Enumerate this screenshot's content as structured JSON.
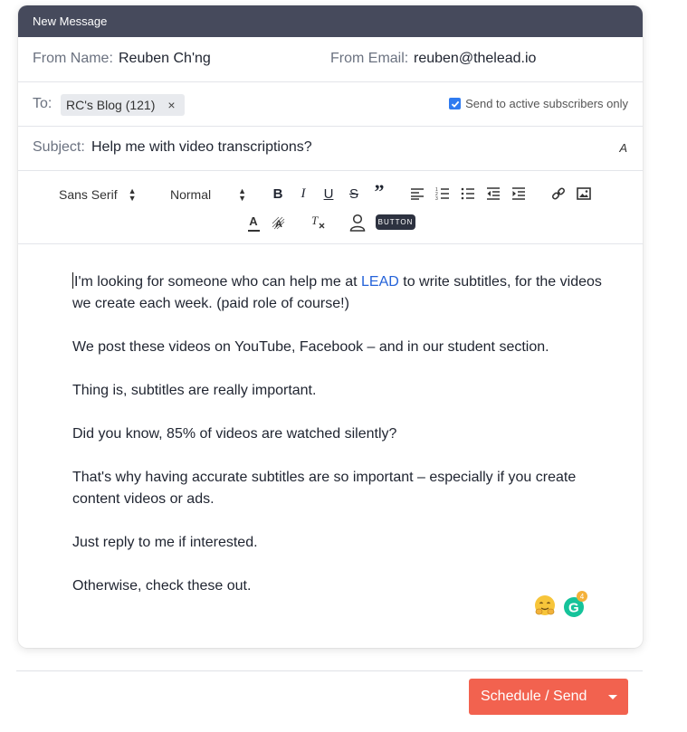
{
  "window": {
    "title": "New Message"
  },
  "from": {
    "name_label": "From Name:",
    "name_value": "Reuben Ch'ng",
    "email_label": "From Email:",
    "email_value": "reuben@thelead.io"
  },
  "to": {
    "label": "To:",
    "chip_label": "RC's Blog (121)",
    "chip_remove": "×",
    "checkbox_label": "Send to active subscribers only",
    "checkbox_checked": true
  },
  "subject": {
    "label": "Subject:",
    "value": "Help me with video transcriptions?",
    "format_icon": "A"
  },
  "toolbar": {
    "font_select": "Sans Serif",
    "size_select": "Normal",
    "button_chip": "BUTTON",
    "icons": [
      "bold-icon",
      "italic-icon",
      "underline-icon",
      "strikethrough-icon",
      "blockquote-icon",
      "align-left-icon",
      "ordered-list-icon",
      "bullet-list-icon",
      "outdent-icon",
      "indent-icon",
      "link-icon",
      "image-icon",
      "text-color-icon",
      "highlight-icon",
      "clear-format-icon",
      "person-icon"
    ]
  },
  "body": {
    "p1_before": "I'm looking for someone who can help me at ",
    "p1_link": "LEAD",
    "p1_after": " to write subtitles, for the videos we create each week. (paid role of course!)",
    "p2": "We post these videos on YouTube, Facebook – and in our student section.",
    "p3": "Thing is, subtitles are really important.",
    "p4": "Did you know, 85% of videos are watched silently?",
    "p5": "That's why having accurate subtitles are so important – especially if you create content videos or ads.",
    "p6": "Just reply to me if interested.",
    "p7": "Otherwise, check these out."
  },
  "grammarly": {
    "count": "4"
  },
  "actions": {
    "send_label": "Schedule / Send"
  },
  "colors": {
    "titlebar": "#464a5c",
    "send": "#f2624f",
    "link": "#2563d9",
    "checkbox": "#2f7bf0"
  }
}
